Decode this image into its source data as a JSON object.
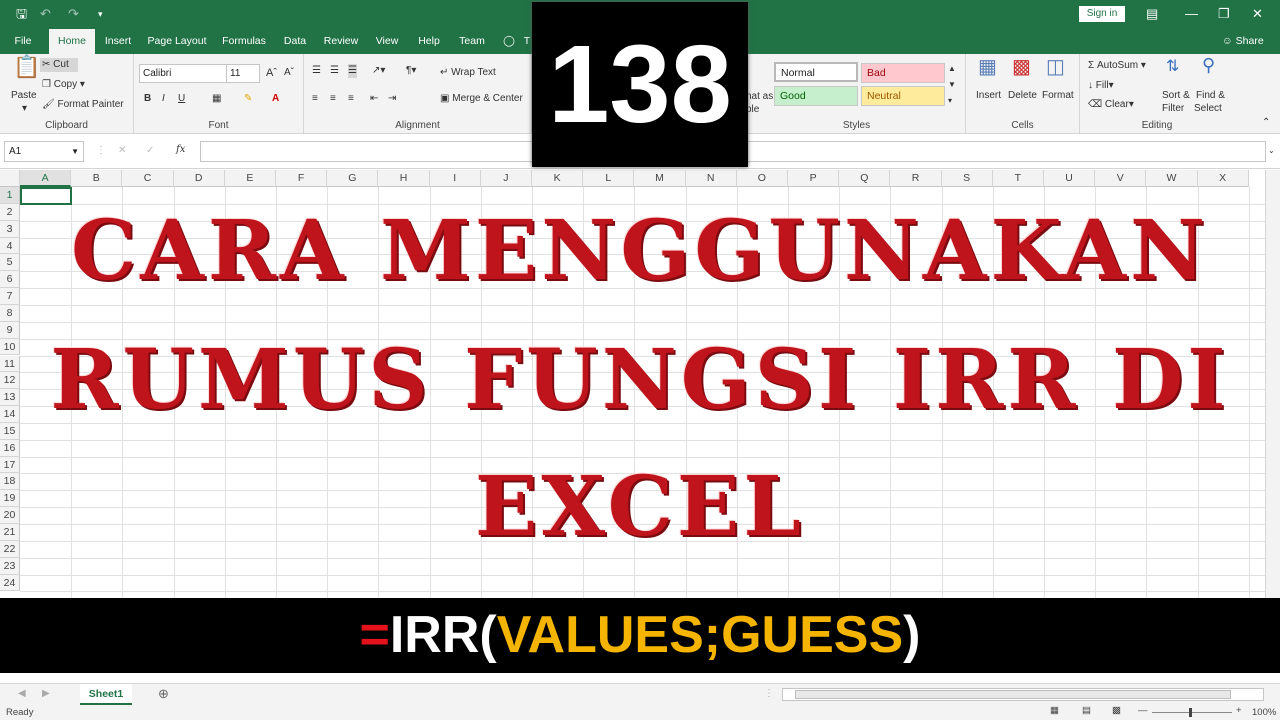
{
  "titlebar": {
    "signin": "Sign in",
    "share": "Share"
  },
  "tabs": [
    {
      "label": "File"
    },
    {
      "label": "Home"
    },
    {
      "label": "Insert"
    },
    {
      "label": "Page Layout"
    },
    {
      "label": "Formulas"
    },
    {
      "label": "Data"
    },
    {
      "label": "Review"
    },
    {
      "label": "View"
    },
    {
      "label": "Help"
    },
    {
      "label": "Team"
    },
    {
      "label": "T"
    }
  ],
  "ribbon": {
    "clipboard": {
      "paste": "Paste",
      "cut": "Cut",
      "copy": "Copy",
      "format_painter": "Format Painter",
      "label": "Clipboard"
    },
    "font": {
      "name": "Calibri",
      "size": "11",
      "label": "Font"
    },
    "alignment": {
      "wrap": "Wrap Text",
      "merge": "Merge & Center",
      "label": "Alignment"
    },
    "styles": {
      "normal": "Normal",
      "bad": "Bad",
      "good": "Good",
      "neutral": "Neutral",
      "format_as": "hat as",
      "table": "ble",
      "label": "Styles"
    },
    "cells": {
      "insert": "Insert",
      "delete": "Delete",
      "format": "Format",
      "label": "Cells"
    },
    "editing": {
      "autosum": "AutoSum",
      "fill": "Fill",
      "clear": "Clear",
      "sort1": "Sort &",
      "sort2": "Filter",
      "find1": "Find &",
      "find2": "Select",
      "label": "Editing"
    }
  },
  "formula_bar": {
    "namebox": "A1",
    "fx": "fx",
    "value": ""
  },
  "columns": [
    "A",
    "B",
    "C",
    "D",
    "E",
    "F",
    "G",
    "H",
    "I",
    "J",
    "K",
    "L",
    "M",
    "N",
    "O",
    "P",
    "Q",
    "R",
    "S",
    "T",
    "U",
    "V",
    "W",
    "X"
  ],
  "rows": [
    "1",
    "2",
    "3",
    "4",
    "5",
    "6",
    "7",
    "8",
    "9",
    "10",
    "11",
    "12",
    "13",
    "14",
    "15",
    "16",
    "17",
    "18",
    "19",
    "20",
    "21",
    "22",
    "23",
    "24"
  ],
  "badge": "138",
  "headline": {
    "line1": "CARA MENGGUNAKAN",
    "line2": "RUMUS FUNGSI IRR DI",
    "line3": "EXCEL"
  },
  "formula": {
    "eq": "=",
    "fn": "IRR(",
    "args": "VALUES;GUESS",
    "close": ")"
  },
  "colors": {
    "eq": "#e4121a",
    "fn": "#ffffff",
    "args": "#f5b400",
    "green": "#217346"
  },
  "sheet": {
    "tab": "Sheet1"
  },
  "status": {
    "ready": "Ready",
    "zoom": "100%"
  }
}
